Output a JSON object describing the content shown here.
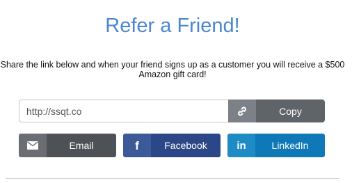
{
  "heading": "Refer a Friend!",
  "description": "Share the link below and when your friend signs up as a customer you will receive a $500 Amazon gift card!",
  "link": {
    "value": "http://ssqt.co",
    "copy_label": "Copy",
    "copy_icon": "link-icon"
  },
  "share": {
    "email": {
      "label": "Email",
      "icon": "envelope-icon",
      "color": "#4e5256"
    },
    "facebook": {
      "label": "Facebook",
      "icon": "facebook-icon",
      "icon_glyph": "f",
      "color": "#2c4787"
    },
    "linkedin": {
      "label": "LinkedIn",
      "icon": "linkedin-icon",
      "icon_glyph": "in",
      "color": "#0e79b6"
    }
  },
  "colors": {
    "heading": "#4a86d4"
  }
}
